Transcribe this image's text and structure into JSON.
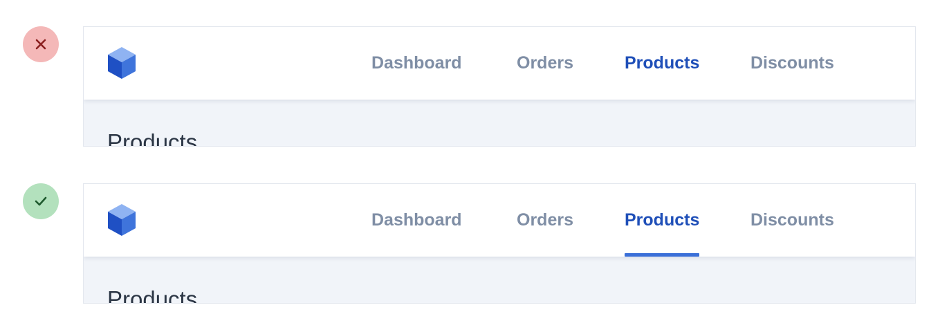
{
  "examples": [
    {
      "verdict": "incorrect",
      "verdict_icon": "close-icon",
      "verdict_color": "#f4b8b8",
      "nav": {
        "items": [
          {
            "label": "Dashboard",
            "active": false
          },
          {
            "label": "Orders",
            "active": false
          },
          {
            "label": "Products",
            "active": true
          },
          {
            "label": "Discounts",
            "active": false
          }
        ],
        "active_underline": false
      },
      "page_title": "Products"
    },
    {
      "verdict": "correct",
      "verdict_icon": "check-icon",
      "verdict_color": "#b3e1bd",
      "nav": {
        "items": [
          {
            "label": "Dashboard",
            "active": false
          },
          {
            "label": "Orders",
            "active": false
          },
          {
            "label": "Products",
            "active": true
          },
          {
            "label": "Discounts",
            "active": false
          }
        ],
        "active_underline": true
      },
      "page_title": "Products"
    }
  ],
  "colors": {
    "nav_inactive": "#7f8ea5",
    "nav_active": "#1f4fb8",
    "active_underline": "#3a6fd8",
    "content_background": "#f1f4f9",
    "logo_cube": "#3f74db"
  },
  "logo_icon": "cube-icon"
}
